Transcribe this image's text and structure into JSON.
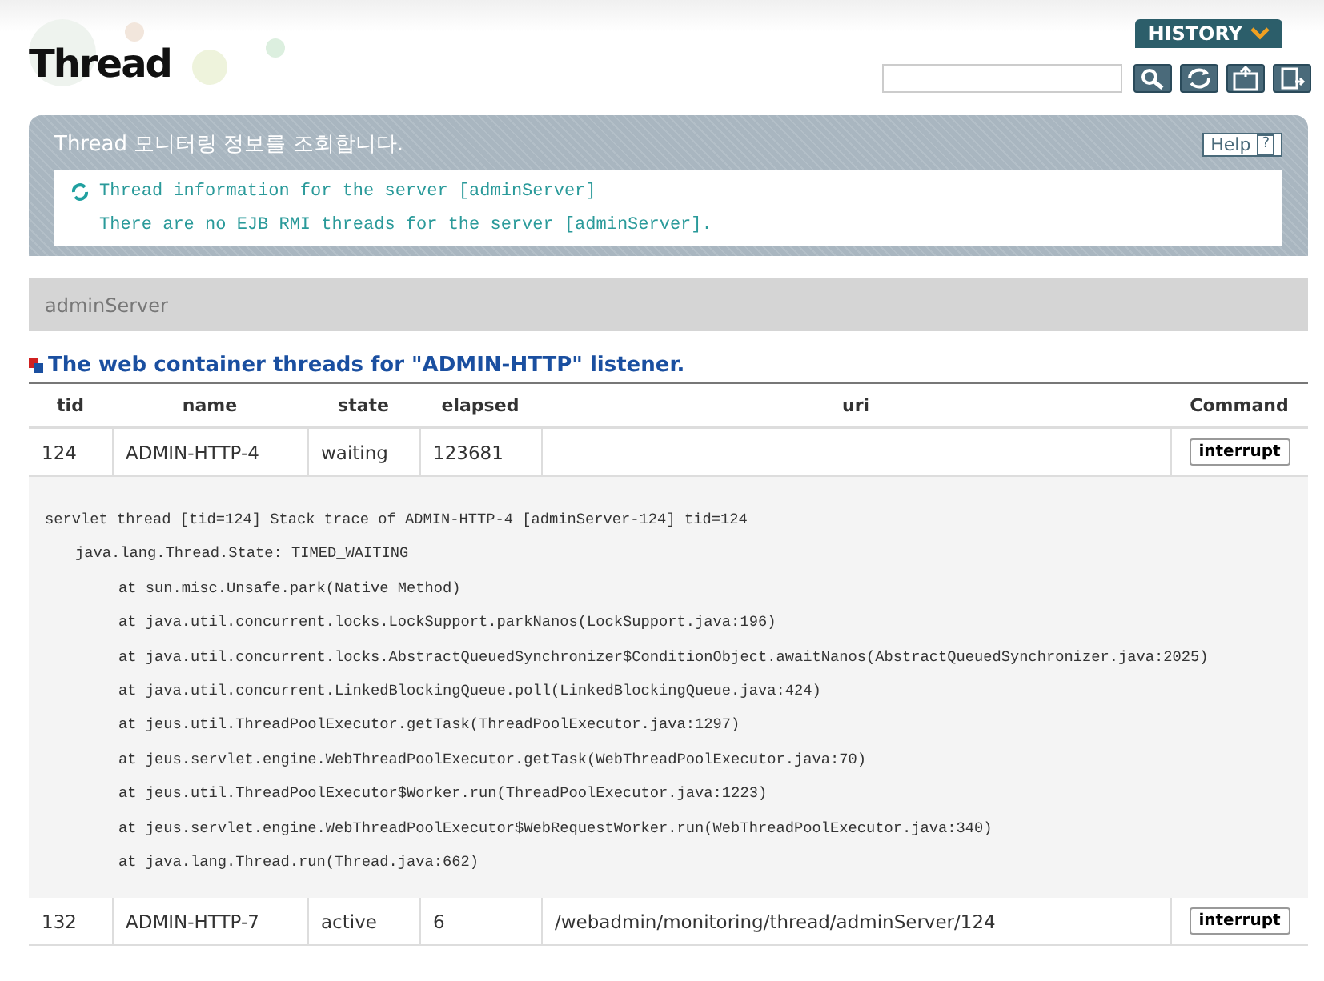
{
  "page_title": "Thread",
  "history_button": "HISTORY",
  "info_panel": {
    "title": "Thread 모니터링 정보를 조회합니다.",
    "help": "Help",
    "help_icon": "?",
    "messages": [
      "Thread information for the server [adminServer]",
      "There are no EJB RMI threads for the server [adminServer]."
    ]
  },
  "server_bar": "adminServer",
  "section_title": "The web container threads for \"ADMIN-HTTP\" listener.",
  "table": {
    "columns": [
      "tid",
      "name",
      "state",
      "elapsed",
      "uri",
      "Command"
    ],
    "rows": [
      {
        "tid": "124",
        "name": "ADMIN-HTTP-4",
        "state": "waiting",
        "elapsed": "123681",
        "uri": "",
        "command": "interrupt",
        "trace": {
          "header": "servlet thread [tid=124] Stack trace of ADMIN-HTTP-4 [adminServer-124] tid=124",
          "state": "java.lang.Thread.State: TIMED_WAITING",
          "frames": [
            "at sun.misc.Unsafe.park(Native Method)",
            "at java.util.concurrent.locks.LockSupport.parkNanos(LockSupport.java:196)",
            "at java.util.concurrent.locks.AbstractQueuedSynchronizer$ConditionObject.awaitNanos(AbstractQueuedSynchronizer.java:2025)",
            "at java.util.concurrent.LinkedBlockingQueue.poll(LinkedBlockingQueue.java:424)",
            "at jeus.util.ThreadPoolExecutor.getTask(ThreadPoolExecutor.java:1297)",
            "at jeus.servlet.engine.WebThreadPoolExecutor.getTask(WebThreadPoolExecutor.java:70)",
            "at jeus.util.ThreadPoolExecutor$Worker.run(ThreadPoolExecutor.java:1223)",
            "at jeus.servlet.engine.WebThreadPoolExecutor$WebRequestWorker.run(WebThreadPoolExecutor.java:340)",
            "at java.lang.Thread.run(Thread.java:662)"
          ]
        }
      },
      {
        "tid": "132",
        "name": "ADMIN-HTTP-7",
        "state": "active",
        "elapsed": "6",
        "uri": "/webadmin/monitoring/thread/adminServer/124",
        "command": "interrupt"
      }
    ]
  }
}
